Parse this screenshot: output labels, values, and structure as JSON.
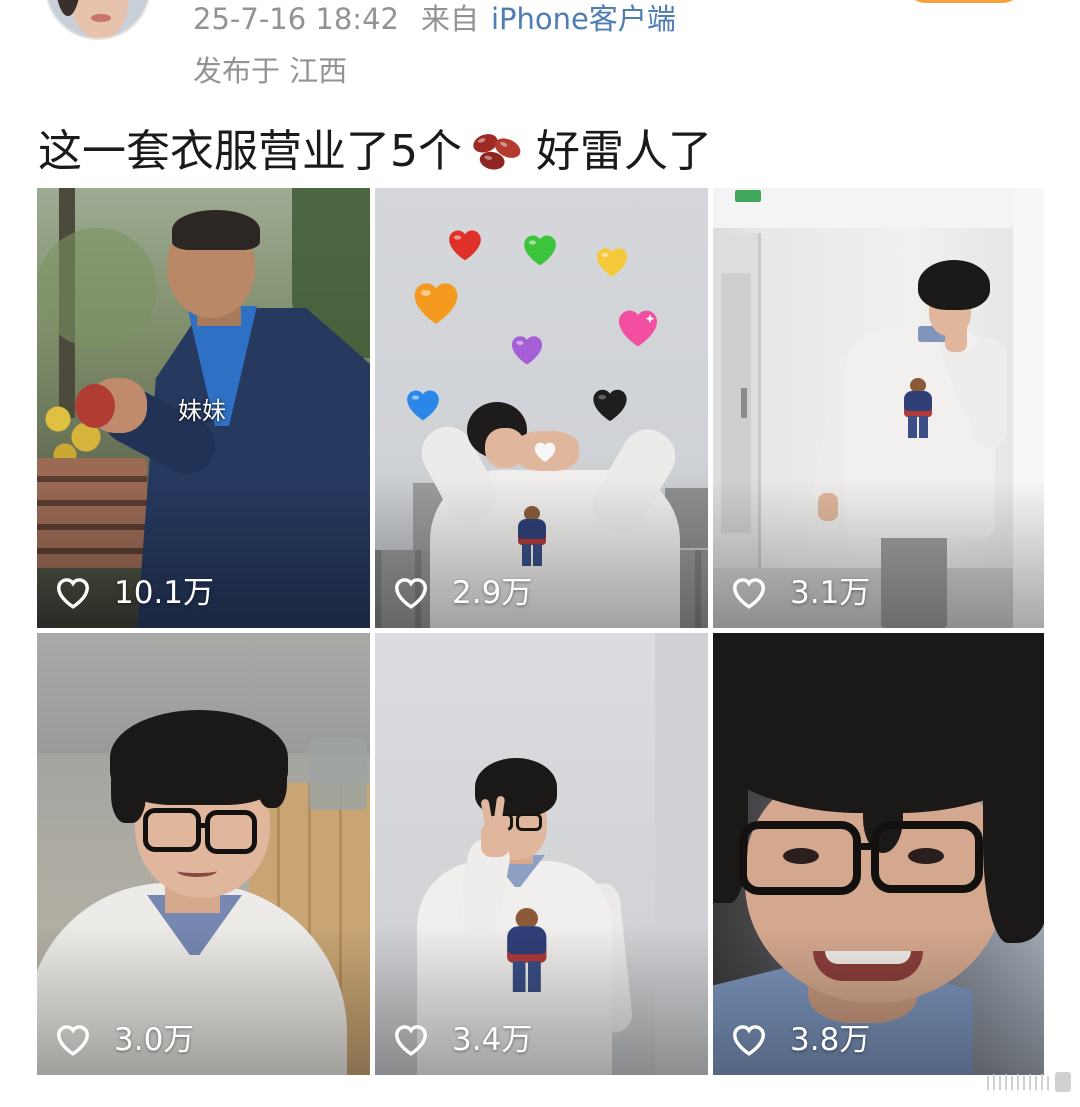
{
  "post": {
    "timestamp": "25-7-16 18:42",
    "source_prefix": "来自",
    "source_client": "iPhone客户端",
    "location": "发布于 江西",
    "text_before_emoji": "这一套衣服营业了5个",
    "emoji_icon": "beans-icon",
    "text_after_emoji": "好雷人了"
  },
  "tiles": [
    {
      "likes": "10.1万",
      "caption": "妹妹"
    },
    {
      "likes": "2.9万"
    },
    {
      "likes": "3.1万"
    },
    {
      "likes": "3.0万"
    },
    {
      "likes": "3.4万"
    },
    {
      "likes": "3.8万"
    }
  ],
  "icons": {
    "like": "heart-outline-icon",
    "avatar": "user-avatar"
  },
  "colors": {
    "text": "#1a1a1a",
    "meta": "#939393",
    "link": "#4f7cb3",
    "follow": "#f8a13a",
    "like_text": "#ffffff",
    "page_bg": "#ffffff"
  }
}
